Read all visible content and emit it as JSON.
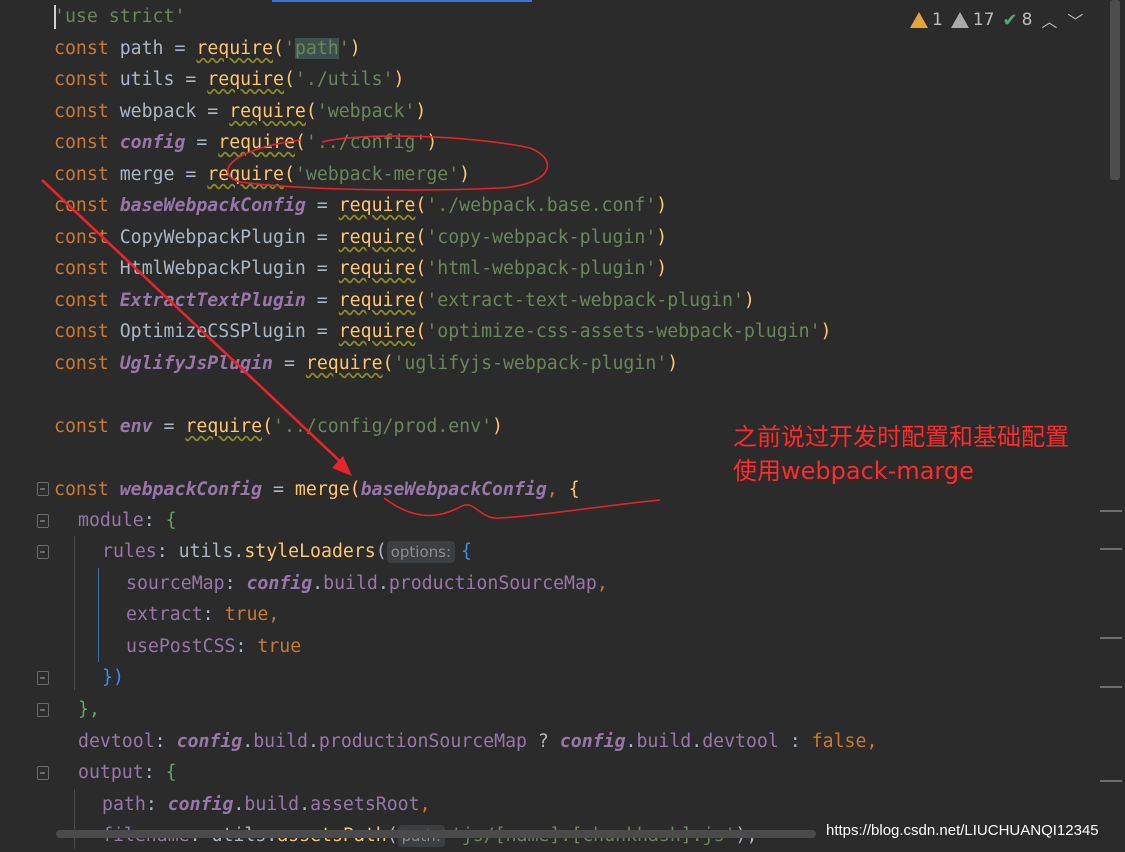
{
  "inspections": {
    "errors": "1",
    "warnings": "17",
    "weak": "8"
  },
  "code": {
    "l1": "'use strict'",
    "l2_a": "const ",
    "l2_b": "path",
    "l2_c": " = ",
    "l2_d": "require",
    "l2_e": "(",
    "l2_f": "'",
    "l2_g": "path",
    "l2_h": "'",
    "l2_i": ")",
    "l3": [
      "const ",
      "utils",
      " = ",
      "require",
      "(",
      "'./utils'",
      ")"
    ],
    "l4": [
      "const ",
      "webpack",
      " = ",
      "require",
      "(",
      "'webpack'",
      ")"
    ],
    "l5": [
      "const ",
      "config",
      " = ",
      "require",
      "(",
      "'../config'",
      ")"
    ],
    "l6": [
      "const ",
      "merge",
      " = ",
      "require",
      "(",
      "'webpack-merge'",
      ")"
    ],
    "l7": [
      "const ",
      "baseWebpackConfig",
      " = ",
      "require",
      "(",
      "'./webpack.base.conf'",
      ")"
    ],
    "l8": [
      "const ",
      "CopyWebpackPlugin",
      " = ",
      "require",
      "(",
      "'copy-webpack-plugin'",
      ")"
    ],
    "l9": [
      "const ",
      "HtmlWebpackPlugin",
      " = ",
      "require",
      "(",
      "'html-webpack-plugin'",
      ")"
    ],
    "l10": [
      "const ",
      "ExtractTextPlugin",
      " = ",
      "require",
      "(",
      "'extract-text-webpack-plugin'",
      ")"
    ],
    "l11": [
      "const ",
      "OptimizeCSSPlugin",
      " = ",
      "require",
      "(",
      "'optimize-css-assets-webpack-plugin'",
      ")"
    ],
    "l12": [
      "const ",
      "UglifyJsPlugin",
      " = ",
      "require",
      "(",
      "'uglifyjs-webpack-plugin'",
      ")"
    ],
    "l14": [
      "const ",
      "env",
      " = ",
      "require",
      "(",
      "'../config/prod.env'",
      ")"
    ],
    "l16": [
      "const ",
      "webpackConfig",
      " = ",
      "merge",
      "(",
      "baseWebpackConfig",
      ", ",
      "{"
    ],
    "l17": [
      "module",
      ": ",
      "{"
    ],
    "l18": [
      "rules",
      ": ",
      "utils",
      ".",
      "styleLoaders",
      "(",
      "options:",
      "{"
    ],
    "l19": [
      "sourceMap",
      ": ",
      "config",
      ".",
      "build",
      ".",
      "productionSourceMap",
      ","
    ],
    "l20": [
      "extract",
      ": ",
      "true",
      ","
    ],
    "l21": [
      "usePostCSS",
      ": ",
      "true"
    ],
    "l22": [
      "})"
    ],
    "l23": [
      "},"
    ],
    "l24": [
      "devtool",
      ": ",
      "config",
      ".",
      "build",
      ".",
      "productionSourceMap",
      " ? ",
      "config",
      ".",
      "build",
      ".",
      "devtool",
      " : ",
      "false",
      ","
    ],
    "l25": [
      "output",
      ": ",
      "{"
    ],
    "l26": [
      "path",
      ": ",
      "config",
      ".",
      "build",
      ".",
      "assetsRoot",
      ","
    ],
    "l27": [
      "filename",
      ": ",
      "utils",
      ".",
      "assetsPath",
      "(",
      "path:",
      "'js/[name].[chunkhash].js'",
      "),"
    ]
  },
  "annotation": {
    "line1": "之前说过开发时配置和基础配置",
    "line2": "使用webpack-marge"
  },
  "watermark": "https://blog.csdn.net/LIUCHUANQI12345",
  "colors": {
    "background": "#2b2b2b",
    "keyword": "#cc7832",
    "string": "#6a8759",
    "function": "#ffc66d",
    "italic_var": "#9876aa",
    "annotation": "#ff2a2a"
  }
}
